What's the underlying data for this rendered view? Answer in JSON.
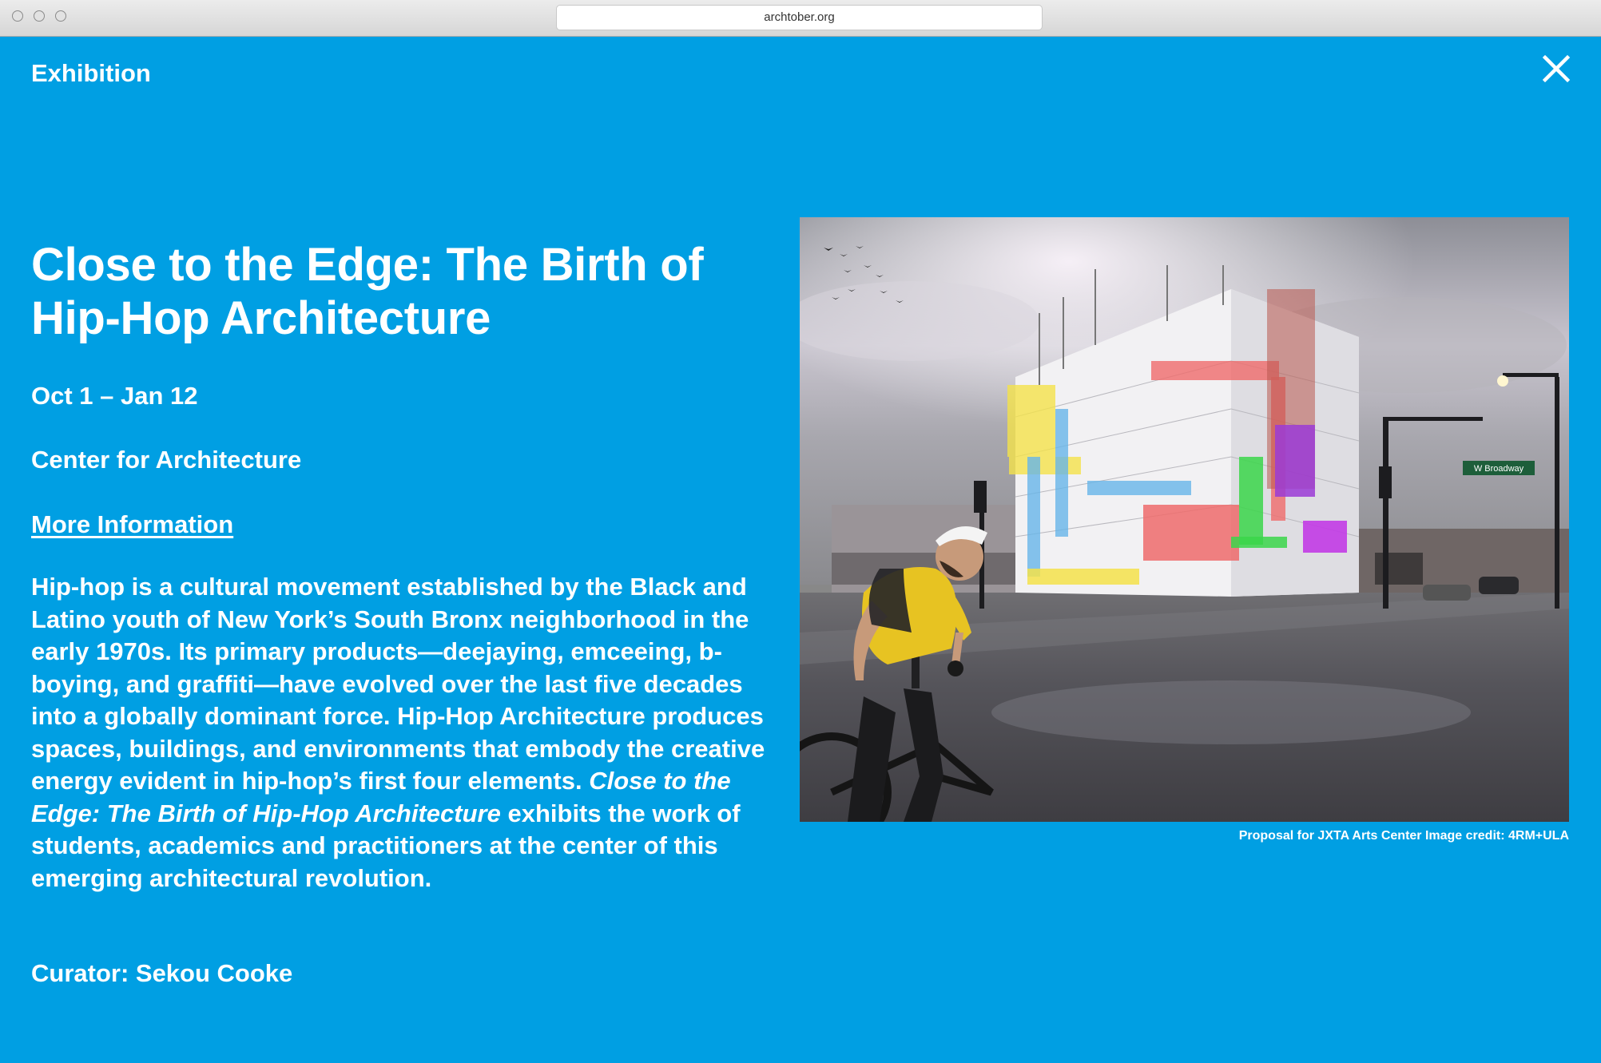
{
  "browser": {
    "url": "archtober.org"
  },
  "header": {
    "section_label": "Exhibition",
    "close_icon": "close-icon"
  },
  "exhibition": {
    "title": "Close to the Edge: The Birth of Hip-Hop Architecture",
    "dates": "Oct 1 – Jan 12",
    "venue": "Center for Architecture",
    "more_info_label": "More Information",
    "description_part1": "Hip-hop is a cultural movement established by the Black and Latino youth of New York’s South Bronx neighborhood in the early 1970s. Its primary products—deejaying, emceeing, b-boying, and graffiti—have evolved over the last five decades into a globally dominant force. Hip-Hop Architecture produces spaces, buildings, and environments that embody the creative energy evident in hip-hop’s first four elements. ",
    "description_italic": "Close to the Edge: The Birth of Hip-Hop Architecture",
    "description_part2": " exhibits the work of students, academics and practitioners at the center of this emerging architectural revolution.",
    "curator": "Curator: Sekou Cooke"
  },
  "image": {
    "street_sign": "W Broadway",
    "caption": "Proposal for JXTA Arts Center Image credit: 4RM+ULA"
  },
  "colors": {
    "background": "#009fe3",
    "text": "#ffffff"
  }
}
